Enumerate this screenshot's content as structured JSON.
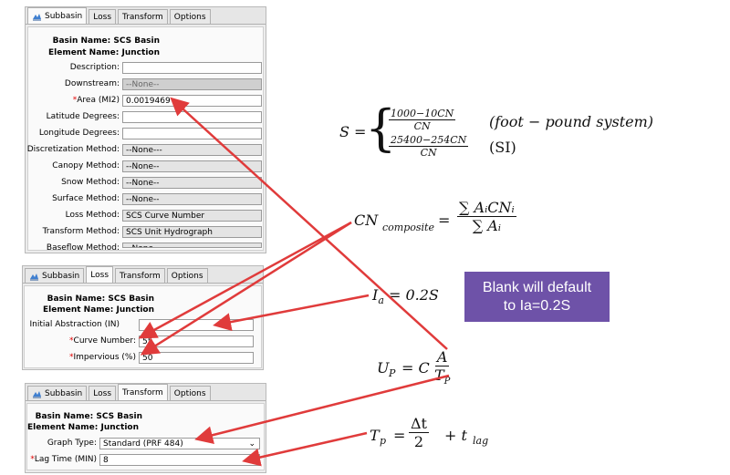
{
  "panel1": {
    "tabs": [
      "Subbasin",
      "Loss",
      "Transform",
      "Options"
    ],
    "basin_label": "Basin Name:",
    "basin_value": "SCS Basin",
    "element_label": "Element Name:",
    "element_value": "Junction",
    "fields": [
      {
        "label": "Description:",
        "value": "",
        "required": false,
        "style": "input"
      },
      {
        "label": "Downstream:",
        "value": "--None--",
        "required": false,
        "style": "disabled"
      },
      {
        "label": "Area (MI2)",
        "value": "0.0019469",
        "required": true,
        "style": "input"
      },
      {
        "label": "Latitude Degrees:",
        "value": "",
        "required": false,
        "style": "input"
      },
      {
        "label": "Longitude Degrees:",
        "value": "",
        "required": false,
        "style": "input"
      },
      {
        "label": "Discretization Method:",
        "value": "--None---",
        "required": false,
        "style": "readonly"
      },
      {
        "label": "Canopy Method:",
        "value": "--None--",
        "required": false,
        "style": "readonly"
      },
      {
        "label": "Snow Method:",
        "value": "--None--",
        "required": false,
        "style": "readonly"
      },
      {
        "label": "Surface Method:",
        "value": "--None--",
        "required": false,
        "style": "readonly"
      },
      {
        "label": "Loss Method:",
        "value": "SCS Curve Number",
        "required": false,
        "style": "readonly"
      },
      {
        "label": "Transform Method:",
        "value": "SCS Unit Hydrograph",
        "required": false,
        "style": "readonly"
      },
      {
        "label": "Baseflow Method:",
        "value": "--None--",
        "required": false,
        "style": "readonly"
      }
    ]
  },
  "panel2": {
    "tabs": [
      "Subbasin",
      "Loss",
      "Transform",
      "Options"
    ],
    "basin_label": "Basin Name:",
    "basin_value": "SCS Basin",
    "element_label": "Element Name:",
    "element_value": "Junction",
    "fields": [
      {
        "label": "Initial Abstraction (IN)",
        "value": "",
        "required": false
      },
      {
        "label": "Curve Number:",
        "value": "55",
        "required": true
      },
      {
        "label": "Impervious (%)",
        "value": "50",
        "required": true
      }
    ]
  },
  "panel3": {
    "tabs": [
      "Subbasin",
      "Loss",
      "Transform",
      "Options"
    ],
    "basin_label": "Basin Name:",
    "basin_value": "SCS Basin",
    "element_label": "Element Name:",
    "element_value": "Junction",
    "graph_type_label": "Graph Type:",
    "graph_type_value": "Standard (PRF 484)",
    "lag_label": "Lag Time (MIN)",
    "lag_value": "8"
  },
  "equations": {
    "s_lhs": "S =",
    "s_case1_num": "1000−10CN",
    "s_case1_den": "CN",
    "s_case1_note": "(foot − pound system)",
    "s_case2_num": "25400−254CN",
    "s_case2_den": "CN",
    "s_case2_note": "(SI)",
    "cn_lhs": "CN",
    "cn_sub": "composite",
    "cn_eq": "=",
    "cn_num": "∑ AᵢCNᵢ",
    "cn_den": "∑ Aᵢ",
    "ia": "I",
    "ia_sub": "a",
    "ia_rhs": "= 0.2S",
    "up_lhs": "U",
    "up_sub": "P",
    "up_eq": "= C",
    "up_num": "A",
    "up_den": "T",
    "up_den_sub": "P",
    "tp_lhs": "T",
    "tp_sub": "p",
    "tp_eq": "=",
    "tp_num": "Δt",
    "tp_den": "2",
    "tp_plus": "+ t",
    "tp_plus_sub": "lag"
  },
  "callout": {
    "line1": "Blank will default",
    "line2": "to Ia=0.2S",
    "color": "#6e52a8"
  },
  "colors": {
    "arrow": "#e03b3b",
    "required_star": "#e00000"
  }
}
